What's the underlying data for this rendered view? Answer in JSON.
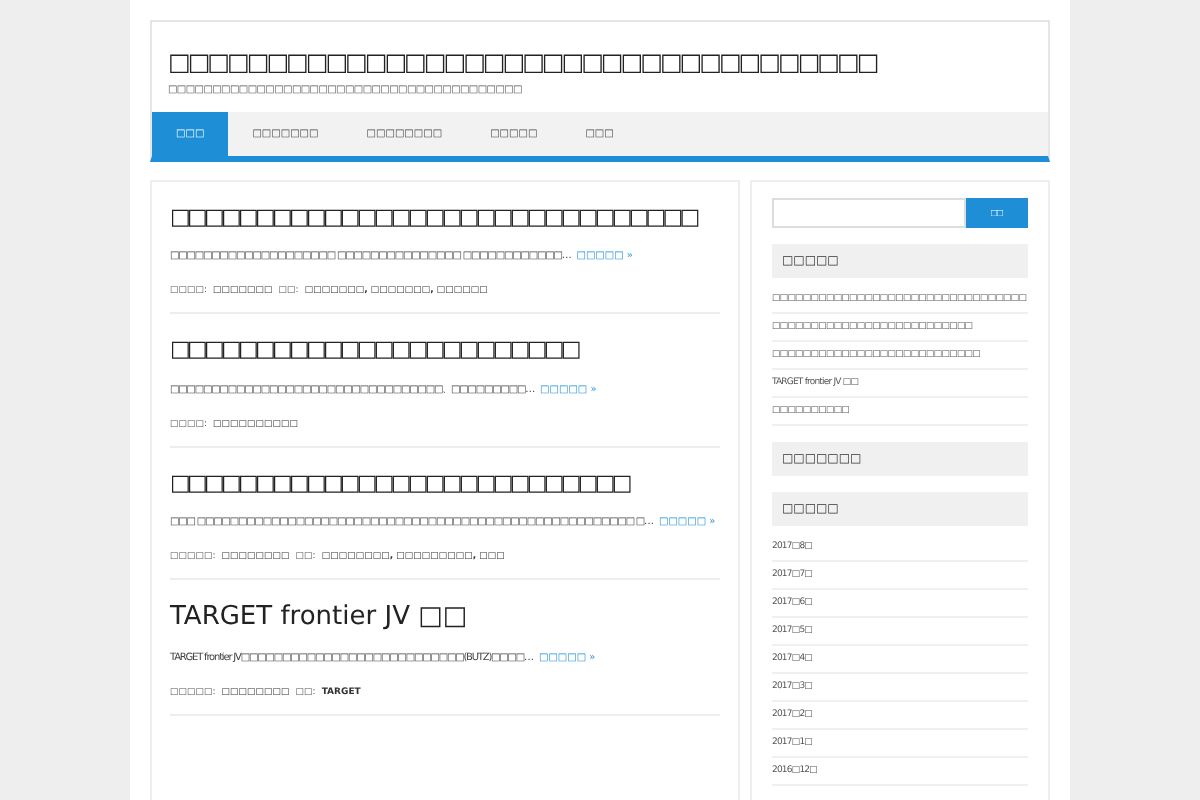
{
  "site": {
    "title": "□□□□□□□□□□□□□□□□□□□□□□□□□□□□□□□□□□□□",
    "tagline": "□□□□□□□□□□□□□□□□□□□□□□□□□□□□□□□□□□□□□□□□"
  },
  "nav": [
    {
      "label": "□□□",
      "selected": true
    },
    {
      "label": "□□□□□□□",
      "selected": false
    },
    {
      "label": "□□□□□□□□",
      "selected": false
    },
    {
      "label": "□□□□□",
      "selected": false
    },
    {
      "label": "□□□",
      "selected": false
    }
  ],
  "posts": [
    {
      "title": "□□□□□□□□□□□□□□□□□□□□□□□□□□□□□□□",
      "excerpt": "□□□□□□□□□□□□□□□□□□□□ □□□□□□□□□□□□□□□ □□□□□□□□□□□□…",
      "more": "□□□□□ »",
      "meta_label": "□□□□:",
      "category": "□□□□□□□",
      "tags_label": "□□:",
      "tags": "□□□□□□□, □□□□□□□, □□□□□□"
    },
    {
      "title": "□□□□□□□□□□□□□□□□□□□□□□□□",
      "excerpt": "□□□□□□□□□□□□□□□□□□□□□□□□□□□□□□□□□、□□□□□□□□□…",
      "more": "□□□□□ »",
      "meta_label": "□□□□:",
      "category": "□□□□□□□□□□"
    },
    {
      "title": "□□□□□□□□□□□□□□□□□□□□□□□□□□□",
      "excerpt": "□□□ □□□□□□□□□□□□□□□□□□□□□□□□□□□□□□□□□□□□□□□□□□□□□□□□□□□□□ □…",
      "more": "□□□□□ »",
      "meta_label": "□□□□□:",
      "category": "□□□□□□□□",
      "tags_label": "□□:",
      "tags": "□□□□□□□□, □□□□□□□□□, □□□"
    },
    {
      "title": "TARGET frontier JV □□",
      "excerpt": "TARGET frontier JV□□□□□□□□□□□□□□□□□□□□□□□□□□□(BUTZ)□□□□…",
      "more": "□□□□□ »",
      "meta_label": "□□□□□:",
      "category": "□□□□□□□□",
      "tags_label": "□□:",
      "tags": "TARGET"
    }
  ],
  "sidebar": {
    "search_button": "□□",
    "widgets": [
      {
        "title": "□□□□□",
        "items": [
          "□□□□□□□□□□□□□□□□□□□□□□□□□□□□□□□□□",
          "□□□□□□□□□□□□□□□□□□□□□□□□□□",
          "□□□□□□□□□□□□□□□□□□□□□□□□□□□",
          "TARGET frontier JV □□",
          "□□□□□□□□□□"
        ]
      },
      {
        "title": "□□□□□□□"
      },
      {
        "title": "□□□□□",
        "items": [
          "2017□8□",
          "2017□7□",
          "2017□6□",
          "2017□5□",
          "2017□4□",
          "2017□3□",
          "2017□2□",
          "2017□1□",
          "2016□12□"
        ]
      }
    ]
  }
}
